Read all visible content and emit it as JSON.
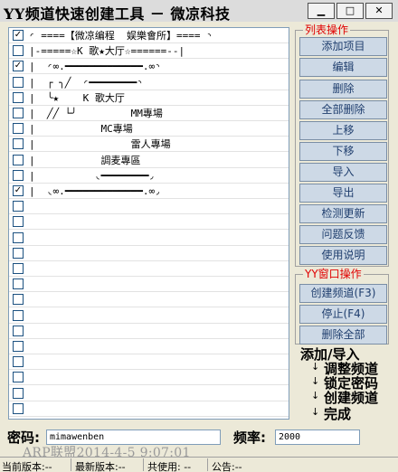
{
  "window": {
    "title": "YY频道快速创建工具 － 微凉科技",
    "minimize_icon": "minimize-icon",
    "maximize_icon": "maximize-icon",
    "close_icon": "close-icon"
  },
  "list": {
    "rows": [
      {
        "checked": true,
        "text": "◜ ====【微凉编程  娱樂會所】==== ◝"
      },
      {
        "checked": false,
        "text": "|-=====☆K 歌★大厅☆======--|"
      },
      {
        "checked": true,
        "text": "|  ◜∞.━━━━━━━━━━━━━.∞◝"
      },
      {
        "checked": false,
        "text": "|  ┌ ╮╱  ◜━━━━━━━━◝"
      },
      {
        "checked": false,
        "text": "|  ╰★    K 歌大厅"
      },
      {
        "checked": false,
        "text": "|  ╱╱ └╯         MM專場"
      },
      {
        "checked": false,
        "text": "|           MC專場"
      },
      {
        "checked": false,
        "text": "|                雷人專場"
      },
      {
        "checked": false,
        "text": "|           調麦專區"
      },
      {
        "checked": false,
        "text": "|          ◟━━━━━━━━◞"
      },
      {
        "checked": true,
        "text": "|  ◟∞.━━━━━━━━━━━━━.∞◞"
      },
      {
        "checked": false,
        "text": ""
      },
      {
        "checked": false,
        "text": ""
      },
      {
        "checked": false,
        "text": ""
      },
      {
        "checked": false,
        "text": ""
      },
      {
        "checked": false,
        "text": ""
      },
      {
        "checked": false,
        "text": ""
      },
      {
        "checked": false,
        "text": ""
      },
      {
        "checked": false,
        "text": ""
      },
      {
        "checked": false,
        "text": ""
      },
      {
        "checked": false,
        "text": ""
      },
      {
        "checked": false,
        "text": ""
      },
      {
        "checked": false,
        "text": ""
      },
      {
        "checked": false,
        "text": ""
      },
      {
        "checked": false,
        "text": ""
      }
    ]
  },
  "list_ops": {
    "label": "列表操作",
    "buttons": [
      "添加项目",
      "编辑",
      "删除",
      "全部删除",
      "上移",
      "下移",
      "导入",
      "导出",
      "检测更新",
      "问题反馈",
      "使用说明"
    ]
  },
  "yy_ops": {
    "label": "YY窗口操作",
    "buttons": [
      "创建频道(F3)",
      "停止(F4)",
      "删除全部"
    ]
  },
  "steps": {
    "items": [
      "添加/导入",
      "调整频道",
      "锁定密码",
      "创建频道",
      "完成"
    ],
    "arrow": "↓"
  },
  "form": {
    "password_label": "密码:",
    "password_value": "mimawenben",
    "frequency_label": "频率:",
    "frequency_value": "2000"
  },
  "watermark": "ARP联盟2014-4-5 9:07:01",
  "statusbar": {
    "current_version": "当前版本:--",
    "latest_version": "最新版本:--",
    "total_used": "共使用: --",
    "notice": "公告:--"
  },
  "colors": {
    "group_label": "#e00000",
    "button_bg": "#cdd9e6",
    "button_text": "#1f3e6e"
  }
}
